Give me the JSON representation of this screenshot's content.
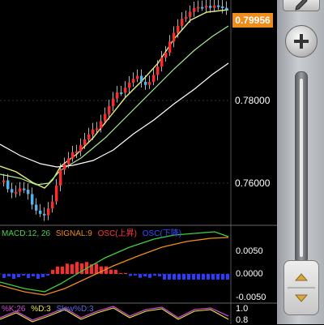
{
  "price_axis": {
    "labels": [
      "0.78000",
      "0.76000"
    ],
    "current_price": "0.79956",
    "current_price_color": "#f08c1a"
  },
  "macd": {
    "label": "MACD:12, 26",
    "signal_label": "SIGNAL:9",
    "osc_label": "OSC(上昇)",
    "osc_down_label": "OSC(下降)",
    "axis_labels": [
      "0.0050",
      "0.0000",
      "-0.0050"
    ],
    "colors": {
      "macd": "#3fcf3f",
      "signal": "#f08c1a",
      "osc_up": "#ff2a2a",
      "osc_down": "#2a3cff"
    }
  },
  "stochastics": {
    "k_label": "%K:26",
    "d_label": "%D:3",
    "slow_label": "Slow%D:3",
    "axis_labels": [
      "1.0",
      "0.8"
    ],
    "colors": {
      "k": "#cc44cc",
      "d": "#e8e83c",
      "slow": "#5a6ad8"
    }
  },
  "candles": {
    "colors": {
      "up": "#ff2a2a",
      "down": "#4ab8f0"
    }
  },
  "moving_averages": {
    "colors": {
      "short": "#e8f07a",
      "mid": "#a8e890",
      "long": "#ffffff"
    }
  },
  "side_panel": {
    "edit_icon": "pencil-icon",
    "zoom_in_icon": "plus-icon",
    "zoom_handle_up_icon": "triangle-up-icon",
    "zoom_handle_down_icon": "triangle-down-icon"
  }
}
